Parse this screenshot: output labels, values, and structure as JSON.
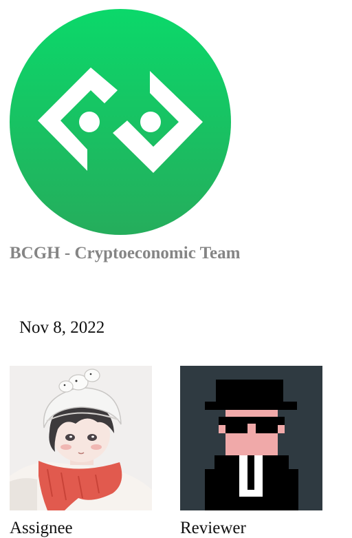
{
  "team": {
    "name": "BCGH - Cryptoeconomic Team",
    "logo_icon": "bcgh-logo",
    "logo_color": "#16c466"
  },
  "date": "Nov 8, 2022",
  "people": {
    "assignee": {
      "label": "Assignee",
      "avatar_icon": "anime-avatar-white-hat-red-scarf"
    },
    "reviewer": {
      "label": "Reviewer",
      "avatar_icon": "pixel-art-avatar-top-hat-sunglasses",
      "background_color": "#2f3a41"
    }
  }
}
